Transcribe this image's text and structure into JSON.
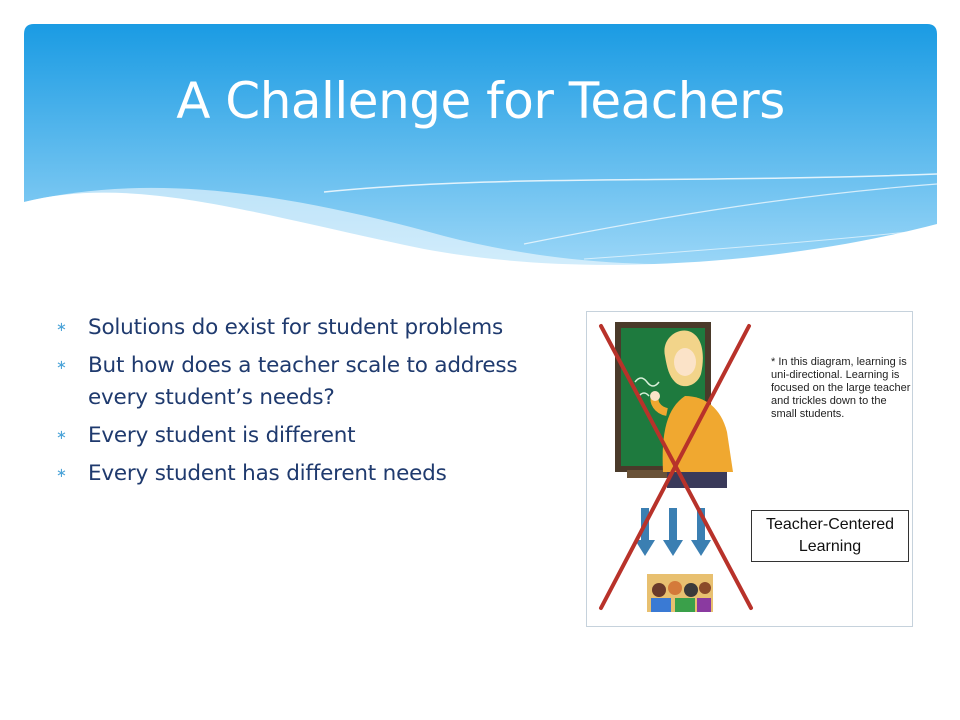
{
  "slide": {
    "title": "A Challenge for Teachers",
    "bullet_symbol": "∗",
    "bullets": [
      "Solutions do exist for student problems",
      "But how does a teacher scale to address every student’s needs?",
      "Every student is different",
      "Every student has different needs"
    ]
  },
  "diagram": {
    "note": "* In this diagram, learning is uni-directional.  Learning is focused on the large teacher and trickles down to the small students.",
    "box_label": "Teacher-Centered Learning"
  },
  "colors": {
    "header_top": "#1a9be3",
    "header_bottom": "#8fd0f5",
    "bullet_text": "#1f3a6e",
    "cross": "#b8322a",
    "chalkboard": "#1e7a3e",
    "arrow": "#3b7fb2"
  }
}
